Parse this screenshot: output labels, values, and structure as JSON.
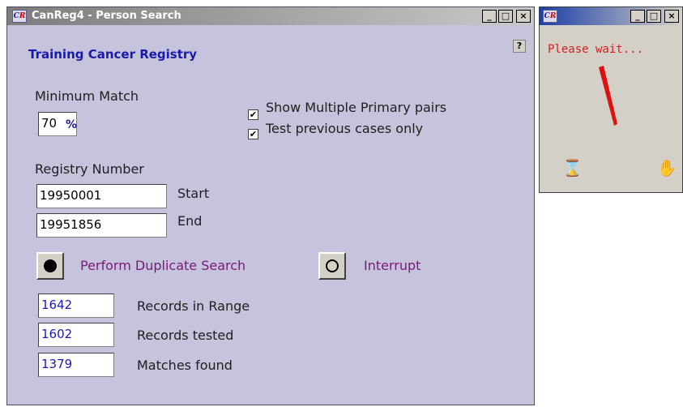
{
  "main_window": {
    "title": "CanReg4 - Person Search",
    "title_buttons": {
      "minimize": "_",
      "maximize": "□",
      "close": "×"
    },
    "help_label": "?",
    "registry_name": "Training Cancer Registry",
    "minimum_match": {
      "label": "Minimum Match",
      "value": "70",
      "unit": "%"
    },
    "options": [
      {
        "label": "Show Multiple Primary pairs",
        "checked": true
      },
      {
        "label": "Test previous cases only",
        "checked": true
      }
    ],
    "registry_number": {
      "label": "Registry Number",
      "start_value": "19950001",
      "start_label": "Start",
      "end_value": "19951856",
      "end_label": "End"
    },
    "actions": {
      "perform_label": "Perform Duplicate Search",
      "interrupt_label": "Interrupt"
    },
    "stats": [
      {
        "value": "1642",
        "label": "Records in Range"
      },
      {
        "value": "1602",
        "label": "Records tested"
      },
      {
        "value": "1379",
        "label": "Matches found"
      }
    ]
  },
  "wait_window": {
    "title_buttons": {
      "minimize": "_",
      "maximize": "□",
      "close": "×"
    },
    "message": "Please wait..."
  },
  "icons": {
    "app_logo": "canreg-logo-icon",
    "help": "help-icon",
    "record": "filled-circle-icon",
    "interrupt": "hollow-circle-icon",
    "progress_needle": "red-needle-icon",
    "hourglass": "hourglass-icon",
    "hand": "hand-icon"
  },
  "colors": {
    "window_bg": "#c6c3dc",
    "registry_name": "#1a1aa8",
    "action_text": "#7a1a7a",
    "stat_values": "#1a1ab4",
    "wait_text": "#d62020",
    "needle": "#e01010"
  }
}
